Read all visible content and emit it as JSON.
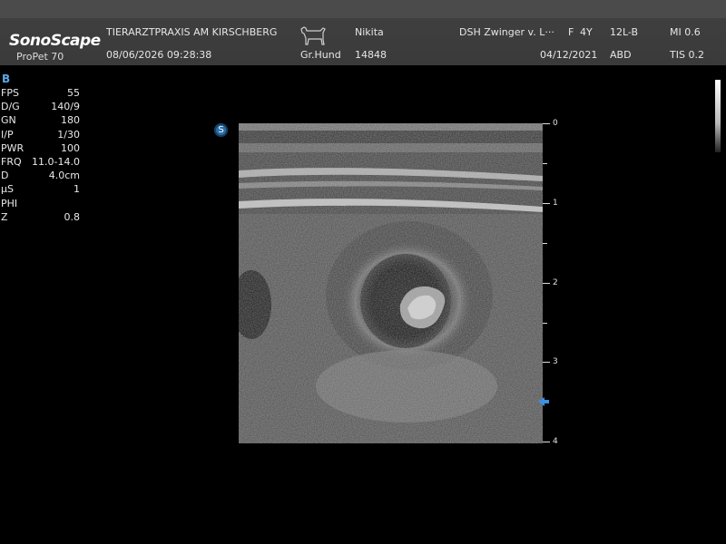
{
  "header": {
    "brand": "SonoScape",
    "model": "ProPet 70",
    "clinic": "TIERARZTPRAXIS AM KIRSCHBERG",
    "datetime": "08/06/2026 09:28:38",
    "patient_name": "Nikita",
    "species": "Gr.Hund",
    "patient_id": "14848",
    "owner": "DSH Zwinger v. L···",
    "sex": "F",
    "age": "4Y",
    "probe": "12L-B",
    "exam_date": "04/12/2021",
    "preset": "ABD",
    "mi": "MI 0.6",
    "tis": "TIS 0.2"
  },
  "mode_label": "B",
  "params": [
    {
      "k": "FPS",
      "v": "55"
    },
    {
      "k": "D/G",
      "v": "140/9"
    },
    {
      "k": "GN",
      "v": "180"
    },
    {
      "k": "I/P",
      "v": "1/30"
    },
    {
      "k": "PWR",
      "v": "100"
    },
    {
      "k": "FRQ",
      "v": "11.0-14.0"
    },
    {
      "k": "D",
      "v": "4.0cm"
    },
    {
      "k": "µS",
      "v": "1"
    },
    {
      "k": "PHI",
      "v": ""
    },
    {
      "k": "Z",
      "v": "0.8"
    }
  ],
  "orientation_marker": "S",
  "depth_scale": [
    "0",
    "1",
    "2",
    "3",
    "4"
  ],
  "depth_cm": 4.0,
  "focus_depth_cm": 3.5,
  "colors": {
    "accent": "#5aa7e6",
    "focus_marker": "#3d8fe0",
    "header_bg": "#3f3f3f"
  },
  "icons": [
    "dog-silhouette-icon",
    "focus-arrow-icon",
    "orientation-marker-icon"
  ]
}
